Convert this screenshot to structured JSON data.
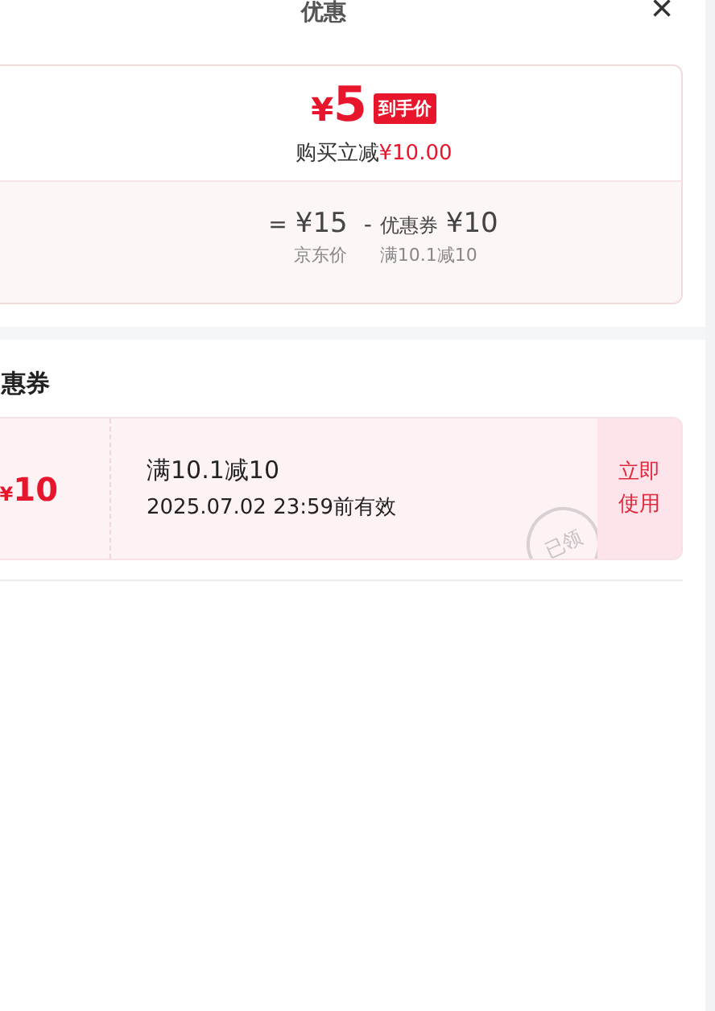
{
  "header": {
    "title": "优惠",
    "close": "×"
  },
  "summary": {
    "price_symbol": "¥",
    "price": "5",
    "price_tag": "到手价",
    "saving_label": "购买立减",
    "saving_amount": "¥10.00",
    "breakdown": [
      {
        "kind": "price",
        "op": "=",
        "amount": "¥15",
        "caption": "京东价"
      },
      {
        "kind": "coupon",
        "op": "-",
        "label": "优惠券",
        "amount": "¥10",
        "caption": "满10.1减10"
      }
    ]
  },
  "coupons_section": {
    "title": "惠券",
    "coupons": [
      {
        "symbol": "¥",
        "value": "10",
        "condition": "满10.1减10",
        "validity": "2025.07.02 23:59前有效",
        "claimed": true,
        "stamp": "已领",
        "action": "立即使用"
      }
    ]
  }
}
